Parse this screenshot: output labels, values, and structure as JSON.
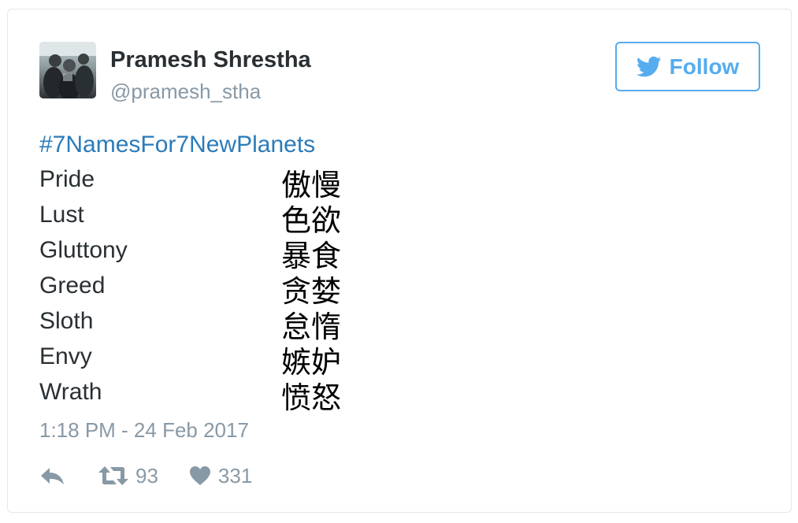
{
  "tweet": {
    "author": {
      "display_name": "Pramesh Shrestha",
      "screen_name": "@pramesh_stha"
    },
    "follow_label": "Follow",
    "hashtag": "#7NamesFor7NewPlanets",
    "sins": [
      {
        "en": "Pride",
        "zh": "傲慢"
      },
      {
        "en": "Lust",
        "zh": "色欲"
      },
      {
        "en": "Gluttony",
        "zh": "暴食"
      },
      {
        "en": "Greed",
        "zh": "贪婪"
      },
      {
        "en": "Sloth",
        "zh": "怠惰"
      },
      {
        "en": "Envy",
        "zh": "嫉妒"
      },
      {
        "en": "Wrath",
        "zh": "愤怒"
      }
    ],
    "timestamp": "1:18 PM - 24 Feb 2017",
    "retweet_count": "93",
    "like_count": "331"
  },
  "colors": {
    "accent": "#55acee",
    "hashtag": "#2b7bb9",
    "muted": "#8899a6",
    "text": "#292f33"
  },
  "icons": {
    "follow": "twitter-bird-icon",
    "reply": "reply-icon",
    "retweet": "retweet-icon",
    "like": "heart-icon"
  }
}
